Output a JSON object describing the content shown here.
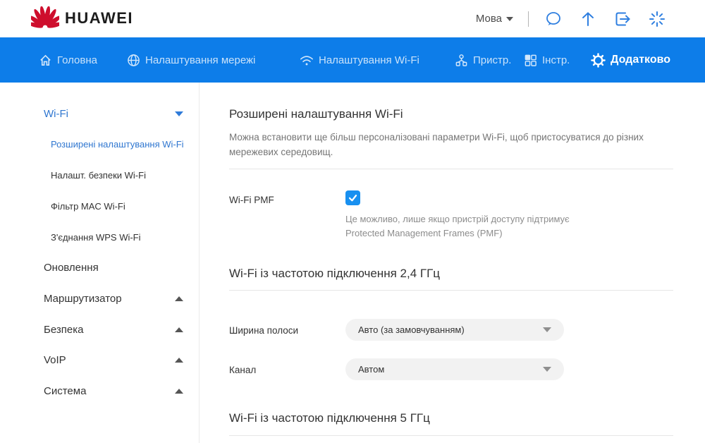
{
  "header": {
    "brand": "HUAWEI",
    "language_label": "Мова",
    "icons": [
      "chat-icon",
      "upload-arrow-icon",
      "logout-icon",
      "loading-spinner-icon"
    ]
  },
  "navbar": {
    "items": [
      {
        "label": "Головна",
        "icon": "home-icon",
        "active": false
      },
      {
        "label": "Налаштування мережі",
        "icon": "globe-icon",
        "active": false
      },
      {
        "label": "Налаштування Wi-Fi",
        "icon": "wifi-icon",
        "active": false
      },
      {
        "label": "Пристр.",
        "icon": "devices-topology-icon",
        "active": false
      },
      {
        "label": "Інстр.",
        "icon": "tools-grid-icon",
        "active": false
      },
      {
        "label": "Додатково",
        "icon": "gear-icon",
        "active": true
      }
    ]
  },
  "sidebar": {
    "items": [
      {
        "label": "Wi-Fi",
        "type": "group",
        "state": "expanded",
        "highlighted": true
      },
      {
        "label": "Розширені налаштування Wi-Fi",
        "type": "sub",
        "selected": true
      },
      {
        "label": "Налашт. безпеки Wi-Fi",
        "type": "sub",
        "selected": false
      },
      {
        "label": "Фільтр MAC Wi-Fi",
        "type": "sub",
        "selected": false
      },
      {
        "label": "З'єднання WPS Wi-Fi",
        "type": "sub",
        "selected": false
      },
      {
        "label": "Оновлення",
        "type": "item"
      },
      {
        "label": "Маршрутизатор",
        "type": "group",
        "state": "collapsed"
      },
      {
        "label": "Безпека",
        "type": "group",
        "state": "collapsed"
      },
      {
        "label": "VoIP",
        "type": "group",
        "state": "collapsed"
      },
      {
        "label": "Система",
        "type": "group",
        "state": "collapsed"
      }
    ]
  },
  "main": {
    "title": "Розширені налаштування Wi-Fi",
    "description": "Можна встановити ще більш персоналізовані параметри Wi-Fi, щоб пристосуватися до різних мережевих середовищ.",
    "pmf": {
      "label": "Wi-Fi PMF",
      "checked": true,
      "help": "Це можливо, лише якщо пристрій доступу підтримує Protected Management Frames (PMF)"
    },
    "section_24ghz": {
      "title": "Wi-Fi із частотою підключення 2,4 ГГц",
      "fields": [
        {
          "label": "Ширина полоси",
          "value": "Авто (за замовчуванням)"
        },
        {
          "label": "Канал",
          "value": "Автом"
        }
      ]
    },
    "section_5ghz": {
      "title": "Wi-Fi із частотою підключення 5 ГГц"
    }
  },
  "colors": {
    "navbar_blue": "#0d7de9",
    "accent_blue": "#3077d0",
    "checkbox_blue": "#1890f0",
    "huawei_red": "#ce0e2d"
  }
}
